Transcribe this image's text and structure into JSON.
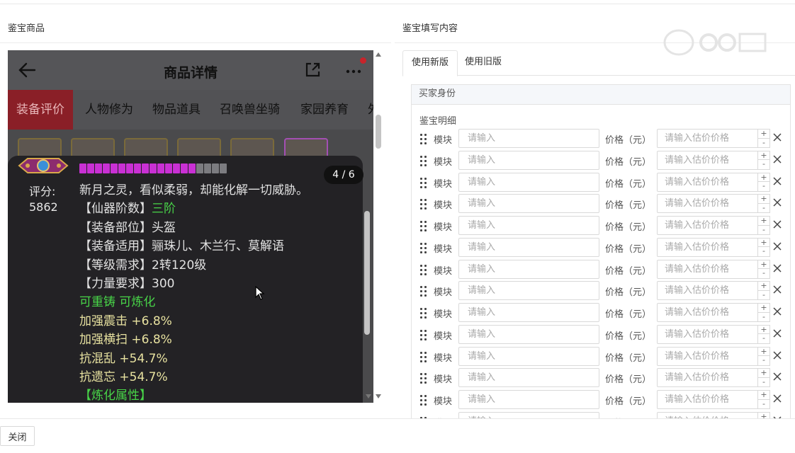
{
  "left": {
    "title": "鉴宝商品",
    "phone": {
      "title": "商品详情",
      "categories": [
        "装备评价",
        "人物修为",
        "物品道具",
        "召唤兽坐骑",
        "家园养育",
        "外"
      ],
      "counter": "4 / 6",
      "score_label": "评分:",
      "score_value": "5862",
      "bars_on": 15,
      "bars_total": 19,
      "lines": [
        {
          "text": "新月之灵，看似柔弱，却能化解一切威胁。",
          "style": "white"
        },
        {
          "text": "【仙器阶数】",
          "hl": "三阶",
          "style": "white"
        },
        {
          "text": "【装备部位】头盔",
          "style": "white"
        },
        {
          "text": "【装备适用】骊珠儿、木兰行、莫解语",
          "style": "white"
        },
        {
          "text": "【等级需求】2转120级",
          "style": "white"
        },
        {
          "text": "【力量要求】300",
          "style": "white"
        },
        {
          "text": "可重铸 可炼化",
          "style": "green"
        },
        {
          "text": "加强震击 +6.8%",
          "style": "yellow"
        },
        {
          "text": "加强横扫 +6.8%",
          "style": "yellow"
        },
        {
          "text": "抗混乱 +54.7%",
          "style": "yellow"
        },
        {
          "text": "抗遗忘 +54.7%",
          "style": "yellow"
        },
        {
          "text": "【炼化属性】",
          "style": "green"
        }
      ]
    }
  },
  "right": {
    "title": "鉴宝填写内容",
    "tabs": [
      "使用新版",
      "使用旧版"
    ],
    "panel_head": "买家身份",
    "detail_label": "鉴宝明细",
    "row_template": {
      "module_label": "模块",
      "module_placeholder": "请输入",
      "price_label": "价格（元）",
      "price_placeholder": "请输入估价价格",
      "plus": "+",
      "minus": "-"
    },
    "row_count": 14
  },
  "footer": {
    "close_label": "关闭"
  },
  "colors": {
    "accent_red": "#8a1f27",
    "green_text": "#48d548",
    "yellow_text": "#e8e2a0",
    "bar_purple": "#c930d4"
  }
}
